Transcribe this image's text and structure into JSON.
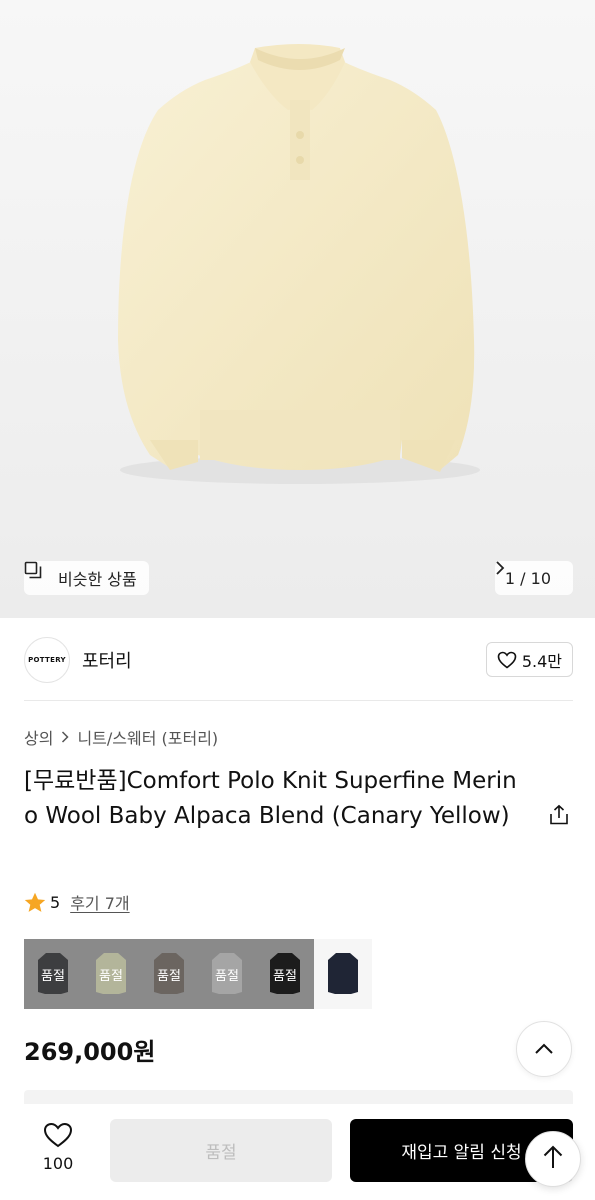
{
  "gallery": {
    "similar_label": "비슷한 상품",
    "counter": "1 / 10"
  },
  "brand": {
    "logo_text": "POTTERY",
    "name": "포터리",
    "like_count": "5.4만"
  },
  "breadcrumb": {
    "category": "상의",
    "subcategory": "니트/스웨터 (포터리)"
  },
  "product": {
    "title": "[무료반품]Comfort Polo Knit Superfine Merino Wool Baby Alpaca Blend (Canary Yellow)",
    "rating": "5",
    "review_link": "후기 7개",
    "price": "269,000원"
  },
  "colors": {
    "soldout_label": "품절",
    "swatches": [
      {
        "color": "#3d3e40",
        "soldout": true
      },
      {
        "color": "#b3b59a",
        "soldout": true
      },
      {
        "color": "#6b6560",
        "soldout": true
      },
      {
        "color": "#8e8e8e",
        "soldout": true
      },
      {
        "color": "#1c1c1c",
        "soldout": true
      },
      {
        "color": "#1f2535",
        "soldout": false
      }
    ]
  },
  "bottom_bar": {
    "wish_count": "100",
    "soldout_label": "품절",
    "restock_label": "재입고 알림 신청"
  },
  "theme": {
    "star_color": "#f6a623",
    "sweater_color": "#f6eccc"
  }
}
